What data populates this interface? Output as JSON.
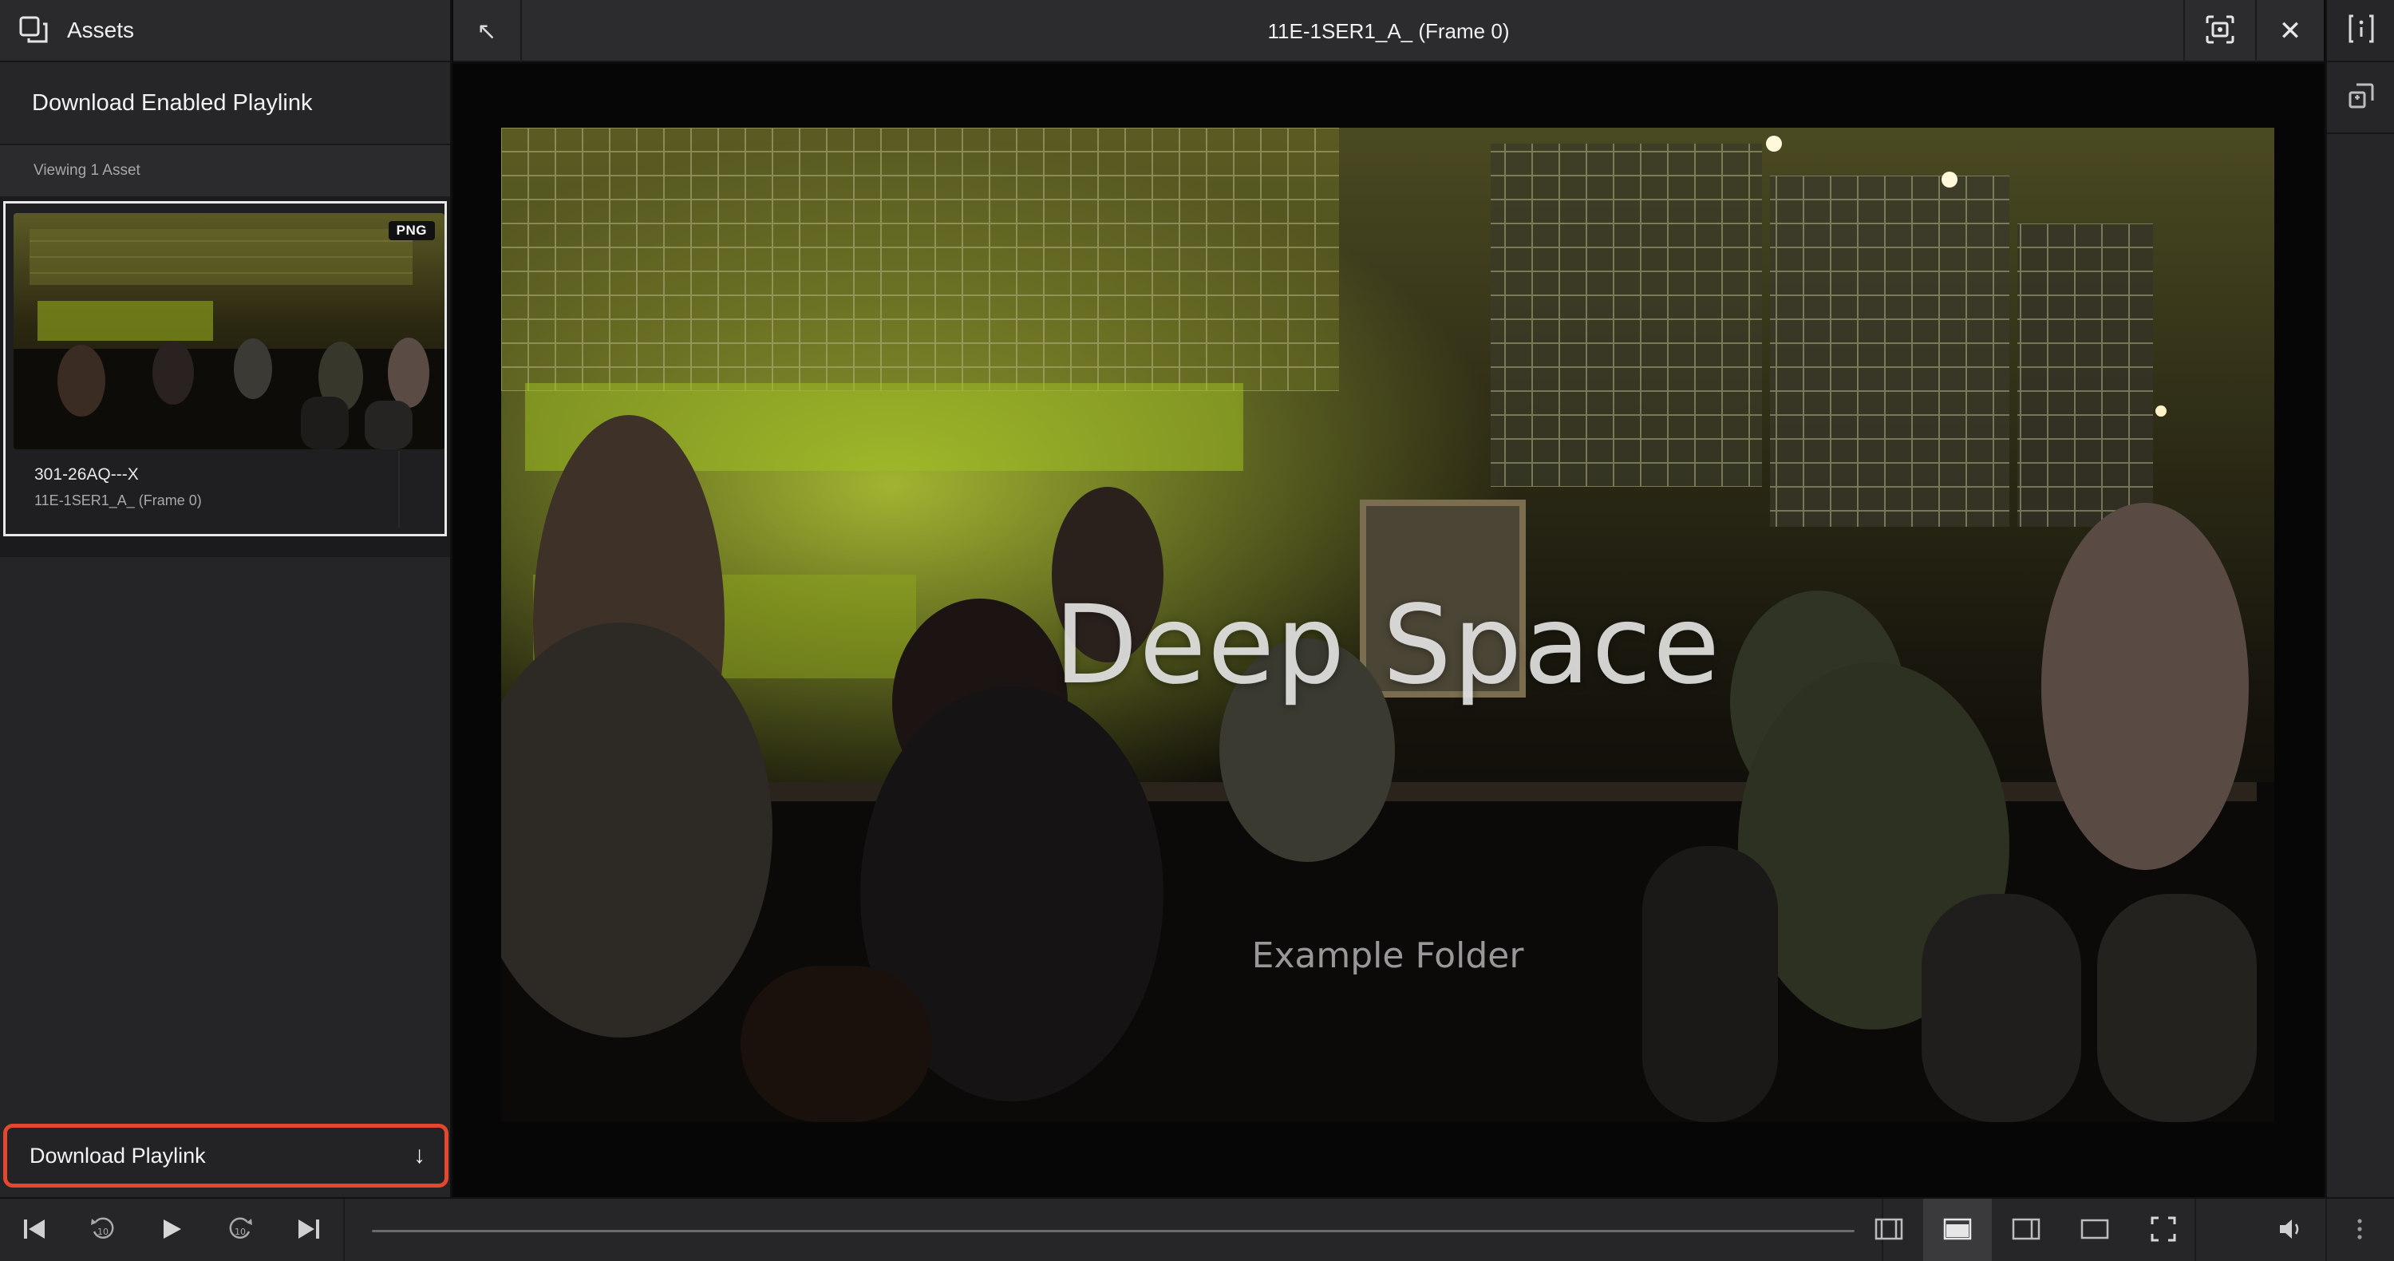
{
  "sidebar": {
    "header_title": "Assets",
    "playlink_title": "Download Enabled Playlink",
    "viewing_count": "Viewing 1 Asset",
    "assets": [
      {
        "badge": "PNG",
        "name": "301-26AQ---X",
        "subtitle": "11E-1SER1_A_ (Frame 0)"
      }
    ],
    "download_button": {
      "label": "Download Playlink",
      "arrow": "↓",
      "highlight_color": "#e4472e"
    }
  },
  "topbar": {
    "back_icon": "↖",
    "title": "11E-1SER1_A_ (Frame 0)",
    "close_icon": "✕"
  },
  "viewer": {
    "overlay_title": "Deep Space",
    "overlay_subtitle": "Example Folder"
  },
  "transport": {
    "progress": 0,
    "layout_active": "layout-top-panel"
  },
  "colors": {
    "sidebar_bg": "#252527",
    "topbar_bg": "#2c2c2e",
    "viewer_bg": "#060606",
    "accent": "#e4472e"
  },
  "icons": {
    "sidebar_header": "assets-icon",
    "focus": "focus-frame-icon",
    "info": "info-brackets-icon",
    "compare": "compare-icon",
    "skip_start": "skip-to-start-icon",
    "rewind": "rewind-10-icon",
    "play": "play-icon",
    "forward": "forward-10-icon",
    "skip_end": "skip-to-end-icon",
    "volume": "volume-icon",
    "more": "more-vertical-icon"
  }
}
